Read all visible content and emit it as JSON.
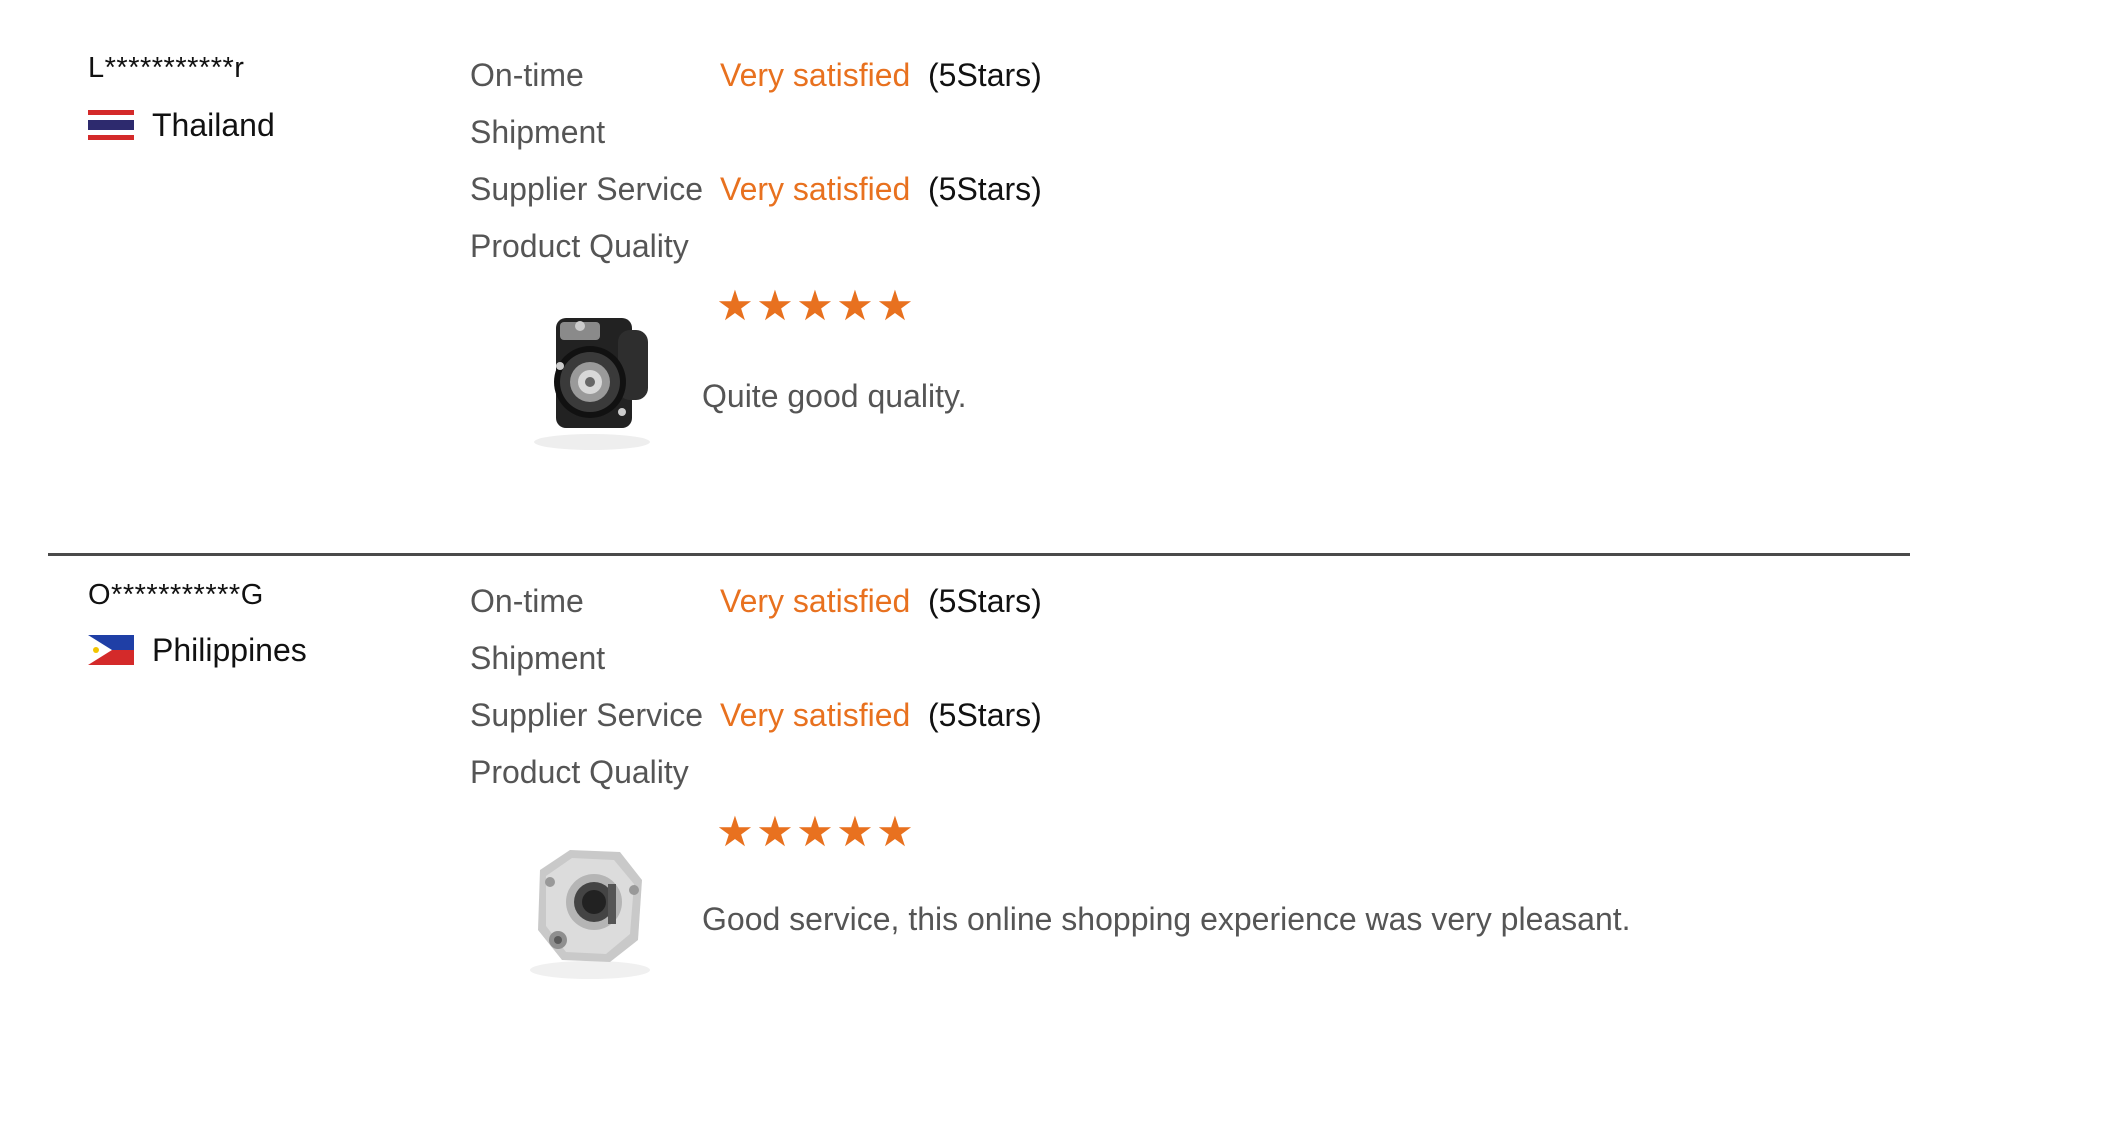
{
  "colors": {
    "accent": "#e8711f",
    "label": "#555555",
    "text": "#111111",
    "divider": "#4a4a4a"
  },
  "reviews": [
    {
      "reviewer": "L***********r",
      "country": "Thailand",
      "flag_icon": "thailand-flag-icon",
      "ratings": [
        {
          "label": "On-time",
          "value": "Very satisfied",
          "stars_text": "(5Stars)"
        },
        {
          "label": "Shipment",
          "value": "",
          "stars_text": ""
        },
        {
          "label": "Supplier Service",
          "value": "Very satisfied",
          "stars_text": "(5Stars)"
        },
        {
          "label": "Product Quality",
          "value": "",
          "stars_text": ""
        }
      ],
      "product_rating": 5,
      "product_icon": "starter-motor-image",
      "comment": "Quite good quality."
    },
    {
      "reviewer": "O***********G",
      "country": "Philippines",
      "flag_icon": "philippines-flag-icon",
      "ratings": [
        {
          "label": "On-time",
          "value": "Very satisfied",
          "stars_text": "(5Stars)"
        },
        {
          "label": "Shipment",
          "value": "",
          "stars_text": ""
        },
        {
          "label": "Supplier Service",
          "value": "Very satisfied",
          "stars_text": "(5Stars)"
        },
        {
          "label": "Product Quality",
          "value": "",
          "stars_text": ""
        }
      ],
      "product_rating": 5,
      "product_icon": "starter-motor-image",
      "comment": "Good service, this online shopping experience was very pleasant."
    }
  ]
}
